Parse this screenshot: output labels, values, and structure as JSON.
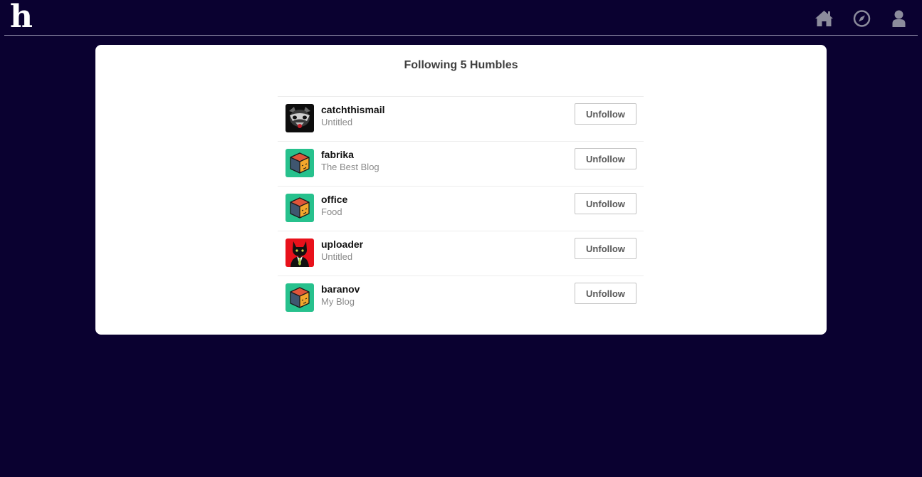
{
  "header": {
    "logo": "h",
    "icons": [
      "home-icon",
      "compass-icon",
      "user-icon"
    ],
    "icon_color": "#8c8c9c",
    "background": "#0a0130"
  },
  "main": {
    "title": "Following 5 Humbles",
    "unfollow_label": "Unfollow",
    "follows": [
      {
        "username": "catchthismail",
        "blog": "Untitled",
        "avatar": "raccoon-avatar"
      },
      {
        "username": "fabrika",
        "blog": "The Best Blog",
        "avatar": "cube-avatar"
      },
      {
        "username": "office",
        "blog": "Food",
        "avatar": "cube-avatar"
      },
      {
        "username": "uploader",
        "blog": "Untitled",
        "avatar": "cat-avatar"
      },
      {
        "username": "baranov",
        "blog": "My Blog",
        "avatar": "cube-avatar"
      }
    ]
  }
}
